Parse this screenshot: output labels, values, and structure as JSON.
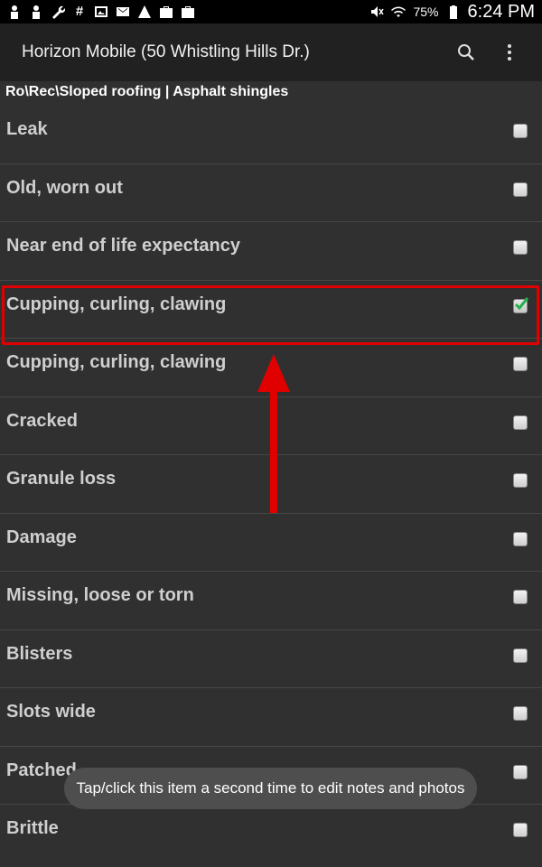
{
  "status_bar": {
    "left_icons": [
      "person-icon",
      "person-icon",
      "wrench-icon",
      "hash-icon",
      "image-icon",
      "mail-icon",
      "warning-icon",
      "briefcase-check-icon",
      "briefcase-icon"
    ],
    "right_icons": [
      "mute-icon",
      "wifi-icon",
      "battery-icon"
    ],
    "battery": "75%",
    "time": "6:24 PM"
  },
  "app_bar": {
    "title": "Horizon Mobile (50 Whistling Hills Dr.)",
    "actions": [
      "search-icon",
      "overflow-menu-icon"
    ]
  },
  "breadcrumb": "Ro\\Rec\\Sloped roofing | Asphalt shingles",
  "items": [
    {
      "label": "Leak",
      "checked": false
    },
    {
      "label": "Old, worn out",
      "checked": false
    },
    {
      "label": "Near end of life expectancy",
      "checked": false
    },
    {
      "label": "Cupping, curling, clawing",
      "checked": true
    },
    {
      "label": "Cupping, curling, clawing",
      "checked": false
    },
    {
      "label": "Cracked",
      "checked": false
    },
    {
      "label": "Granule loss",
      "checked": false
    },
    {
      "label": "Damage",
      "checked": false
    },
    {
      "label": "Missing, loose or torn",
      "checked": false
    },
    {
      "label": "Blisters",
      "checked": false
    },
    {
      "label": "Slots wide",
      "checked": false
    },
    {
      "label": "Patched",
      "checked": false
    },
    {
      "label": "Brittle",
      "checked": false
    }
  ],
  "toast": "Tap/click this item a second time to edit notes and photos",
  "colors": {
    "background": "#303030",
    "app_bar": "#212121",
    "annotation": "#e00000",
    "check": "#22b14c"
  }
}
